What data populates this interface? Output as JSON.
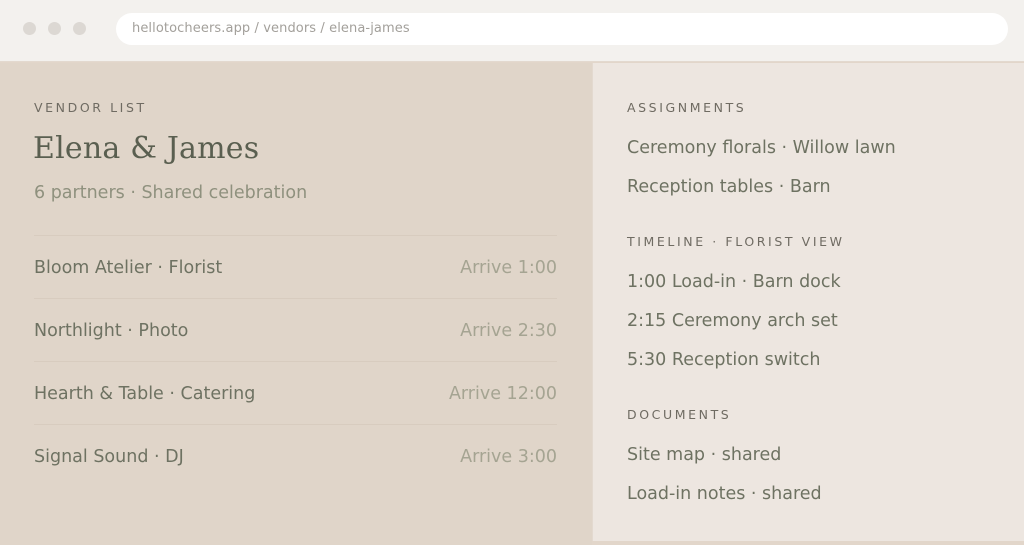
{
  "browser": {
    "url": "hellotocheers.app / vendors / elena-james"
  },
  "left": {
    "eyebrow": "VENDOR LIST",
    "title": "Elena & James",
    "subtitle": "6 partners · Shared celebration",
    "vendors": [
      {
        "name": "Bloom Atelier · Florist",
        "arrive": "Arrive 1:00"
      },
      {
        "name": "Northlight · Photo",
        "arrive": "Arrive 2:30"
      },
      {
        "name": "Hearth & Table · Catering",
        "arrive": "Arrive 12:00"
      },
      {
        "name": "Signal Sound · DJ",
        "arrive": "Arrive 3:00"
      }
    ]
  },
  "right": {
    "assignments": {
      "heading": "ASSIGNMENTS",
      "items": [
        "Ceremony florals · Willow lawn",
        "Reception tables · Barn"
      ]
    },
    "timeline": {
      "heading": "TIMELINE · FLORIST VIEW",
      "items": [
        "1:00 Load-in · Barn dock",
        "2:15 Ceremony arch set",
        "5:30 Reception switch"
      ]
    },
    "documents": {
      "heading": "DOCUMENTS",
      "items": [
        "Site map · shared",
        "Load-in notes · shared"
      ]
    }
  }
}
